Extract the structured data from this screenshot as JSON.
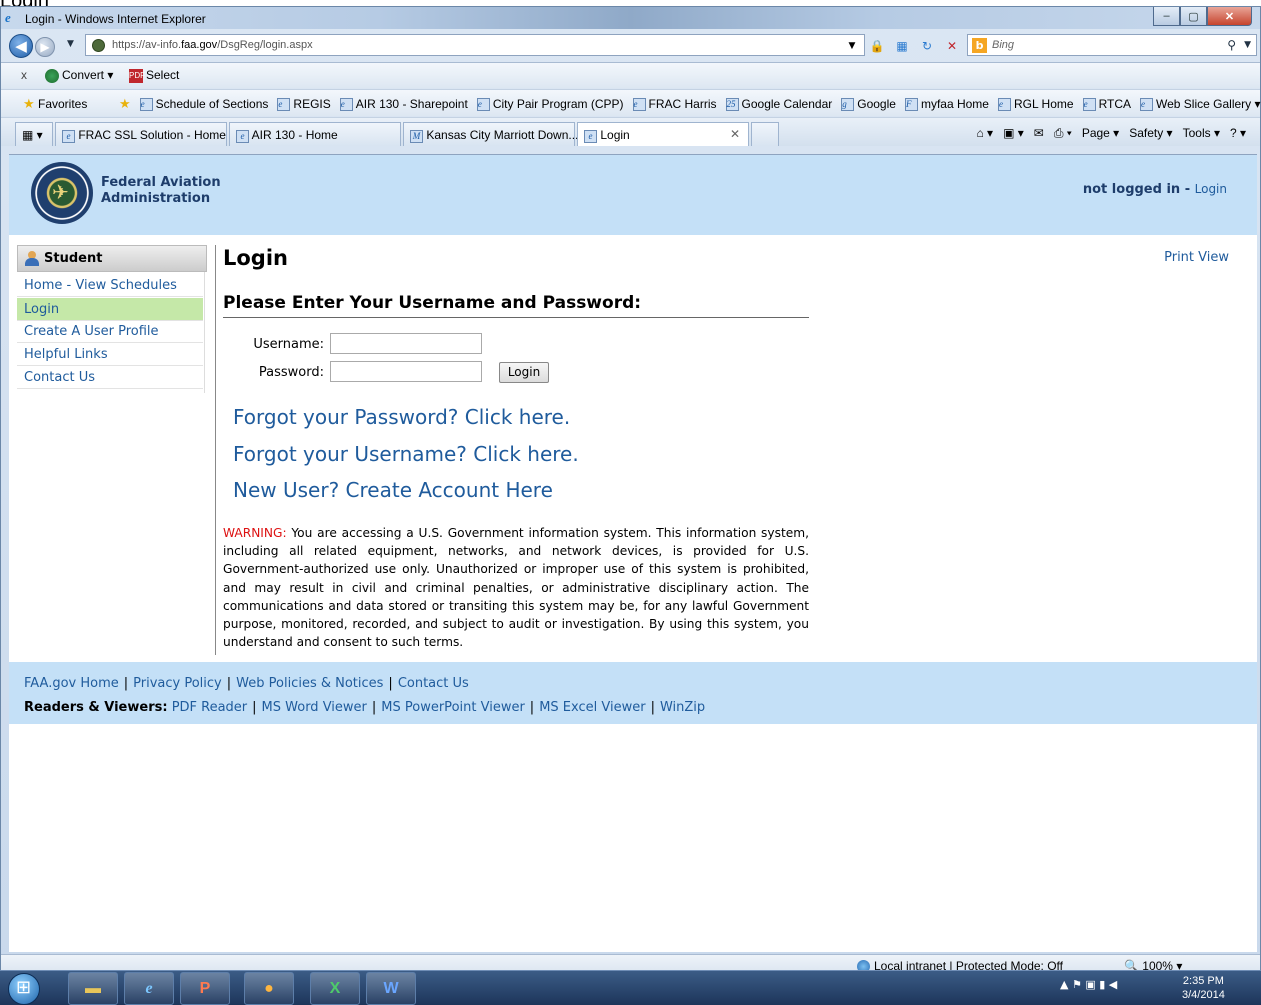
{
  "caption": "Login",
  "window": {
    "title": "Login - Windows Internet Explorer",
    "controls": {
      "minimize": "–",
      "maximize": "▢",
      "close": "✕"
    }
  },
  "address_bar": {
    "url_prefix": "https://av-info.",
    "url_domain": "faa.gov",
    "url_path": "/DsgReg/login.aspx",
    "search_placeholder": "Bing"
  },
  "convert_bar": {
    "close": "x",
    "convert": "Convert",
    "select": "Select"
  },
  "favorites_bar": {
    "favorites": "Favorites",
    "items": [
      "Schedule of Sections",
      "REGIS",
      "AIR 130 - Sharepoint",
      "City Pair Program (CPP)",
      "FRAC Harris",
      "Google Calendar",
      "Google",
      "myfaa Home",
      "RGL Home",
      "RTCA",
      "Web Slice Gallery ▾"
    ]
  },
  "tabs": [
    {
      "label": "FRAC SSL Solution - Home",
      "active": false
    },
    {
      "label": "AIR 130 - Home",
      "active": false
    },
    {
      "label": "Kansas City Marriott Down...",
      "active": false
    },
    {
      "label": "Login",
      "active": true
    }
  ],
  "command_bar": {
    "page": "Page ▾",
    "safety": "Safety ▾",
    "tools": "Tools ▾"
  },
  "header": {
    "org_line1": "Federal Aviation",
    "org_line2": "Administration",
    "status": "not logged in",
    "status_sep": " - ",
    "login_link": "Login"
  },
  "sidebar": {
    "heading": "Student",
    "items": [
      {
        "label": "Home - View Schedules",
        "active": false
      },
      {
        "label": "Login",
        "active": true
      },
      {
        "label": "Create A User Profile",
        "active": false
      },
      {
        "label": "Helpful Links",
        "active": false
      },
      {
        "label": "Contact Us",
        "active": false
      }
    ]
  },
  "main": {
    "title": "Login",
    "print_view": "Print View",
    "subtitle": "Please Enter Your Username and Password:",
    "username_label": "Username:",
    "password_label": "Password:",
    "username_value": "",
    "password_value": "",
    "login_button": "Login",
    "forgot_password": "Forgot your Password? Click here.",
    "forgot_username": "Forgot your Username? Click here.",
    "new_user": "New User? Create Account Here",
    "warning_label": "WARNING:",
    "warning_text": " You are accessing a U.S. Government information system. This information system, including all related equipment, networks, and network devices, is provided for U.S. Government-authorized use only. Unauthorized or improper use of this system is prohibited, and may result in civil and criminal penalties, or administrative disciplinary action. The communications and data stored or transiting this system may be, for any lawful Government purpose, monitored, recorded, and subject to audit or investigation. By using this system, you understand and consent to such terms."
  },
  "footer": {
    "links": [
      "FAA.gov Home",
      "Privacy Policy",
      "Web Policies & Notices",
      "Contact Us"
    ],
    "readers_label": "Readers & Viewers:",
    "readers": [
      "PDF Reader",
      "MS Word Viewer",
      "MS PowerPoint Viewer",
      "MS Excel Viewer",
      "WinZip"
    ]
  },
  "status_bar": {
    "zone": "Local intranet | Protected Mode: Off",
    "zoom": "100%"
  },
  "taskbar": {
    "time": "2:35 PM",
    "date": "3/4/2014"
  }
}
